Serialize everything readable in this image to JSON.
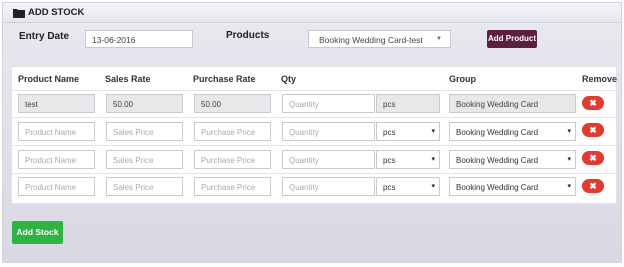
{
  "header": {
    "title": "ADD STOCK",
    "icon": "folder-icon"
  },
  "form": {
    "entry_date_label": "Entry Date",
    "entry_date_value": "13-06-2016",
    "products_label": "Products",
    "products_selected": "Booking Wedding Card-test",
    "add_product_label": "Add Product"
  },
  "table": {
    "headers": [
      "Product Name",
      "Sales Rate",
      "Purchase Rate",
      "Qty",
      "Group",
      "Remove"
    ],
    "first_row": {
      "product_name": "test",
      "sales_rate": "50.00",
      "purchase_rate": "50.00",
      "qty_placeholder": "Quantity",
      "unit": "pcs",
      "group": "Booking Wedding Card"
    },
    "rows": [
      {
        "product_placeholder": "Product Name",
        "sales_placeholder": "Sales Price",
        "purchase_placeholder": "Purchase Price",
        "qty_placeholder": "Quantity",
        "unit": "pcs",
        "group": "Booking Wedding Card"
      },
      {
        "product_placeholder": "Product Name",
        "sales_placeholder": "Sales Price",
        "purchase_placeholder": "Purchase Price",
        "qty_placeholder": "Quantity",
        "unit": "pcs",
        "group": "Booking Wedding Card"
      },
      {
        "product_placeholder": "Product Name",
        "sales_placeholder": "Sales Price",
        "purchase_placeholder": "Purchase Price",
        "qty_placeholder": "Quantity",
        "unit": "pcs",
        "group": "Booking Wedding Card"
      }
    ],
    "remove_glyph": "✖"
  },
  "footer": {
    "add_stock_label": "Add Stock"
  },
  "colors": {
    "accent_dark": "#5d1f3e",
    "remove_red": "#e23a2e",
    "add_green": "#2fb344"
  }
}
